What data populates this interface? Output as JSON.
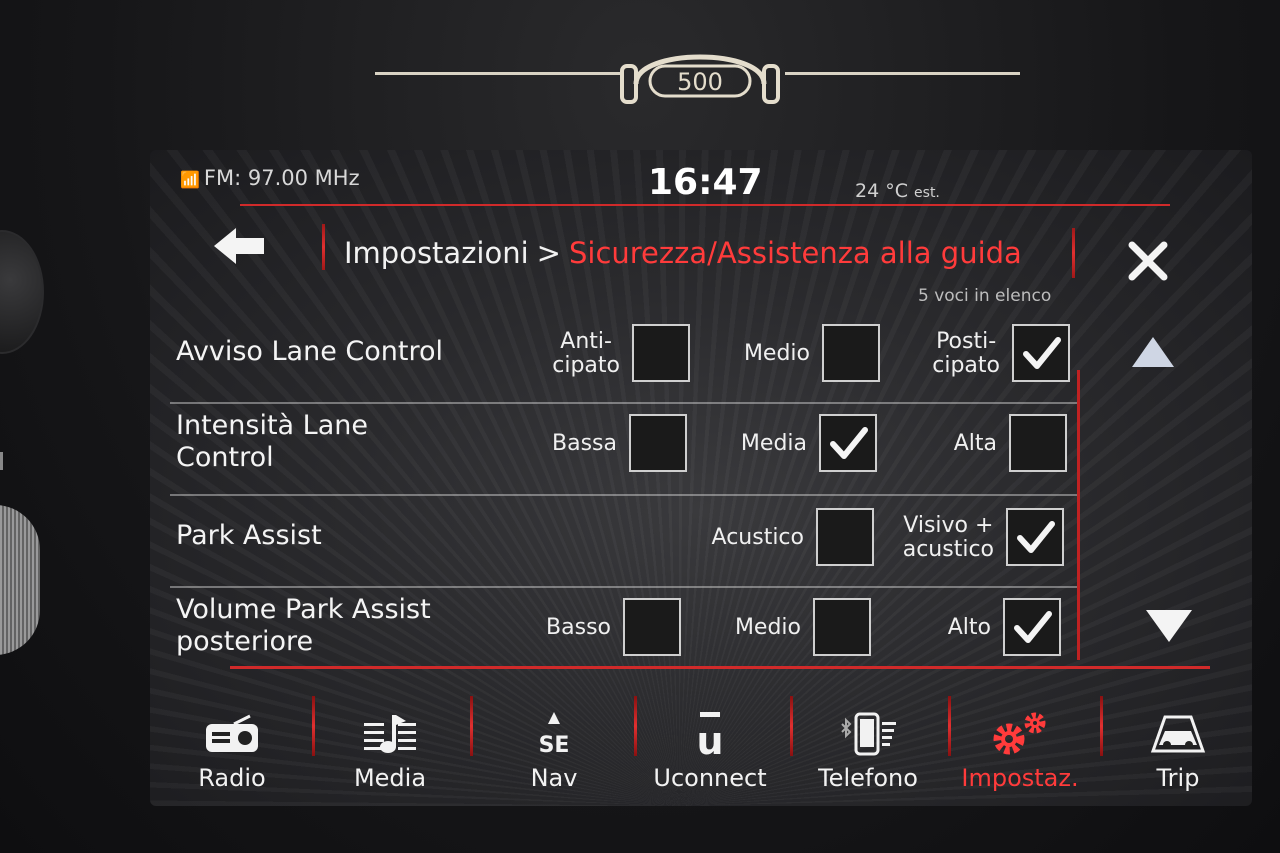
{
  "brand": {
    "logo_text": "500"
  },
  "status": {
    "radio": "FM: 97.00 MHz",
    "clock": "16:47",
    "temperature": "24 °C",
    "temperature_suffix": "est."
  },
  "header": {
    "root": "Impostazioni",
    "separator": ">",
    "current": "Sicurezza/Assistenza alla guida",
    "count": "5 voci in elenco"
  },
  "rows": [
    {
      "label_lines": [
        "Avviso Lane Control"
      ],
      "options": [
        {
          "label_lines": [
            "Anti-",
            "cipato"
          ],
          "checked": false
        },
        {
          "label_lines": [
            "Medio"
          ],
          "checked": false
        },
        {
          "label_lines": [
            "Posti-",
            "cipato"
          ],
          "checked": true
        }
      ]
    },
    {
      "label_lines": [
        "Intensità Lane",
        "Control"
      ],
      "options": [
        {
          "label_lines": [
            "Bassa"
          ],
          "checked": false
        },
        {
          "label_lines": [
            "Media"
          ],
          "checked": true
        },
        {
          "label_lines": [
            "Alta"
          ],
          "checked": false
        }
      ]
    },
    {
      "label_lines": [
        "Park Assist"
      ],
      "options": [
        {
          "label_lines": [
            "Acustico"
          ],
          "checked": false
        },
        {
          "label_lines": [
            "Visivo +",
            "acustico"
          ],
          "checked": true
        }
      ]
    },
    {
      "label_lines": [
        "Volume Park Assist",
        "posteriore"
      ],
      "options": [
        {
          "label_lines": [
            "Basso"
          ],
          "checked": false
        },
        {
          "label_lines": [
            "Medio"
          ],
          "checked": false
        },
        {
          "label_lines": [
            "Alto"
          ],
          "checked": true
        }
      ]
    }
  ],
  "navbar": [
    {
      "label": "Radio",
      "icon": "radio-icon",
      "active": false
    },
    {
      "label": "Media",
      "icon": "media-icon",
      "active": false
    },
    {
      "label": "Nav",
      "icon": "nav-icon",
      "icon_text": "SE",
      "active": false
    },
    {
      "label": "Uconnect",
      "icon": "uconnect-icon",
      "icon_text": "u",
      "active": false
    },
    {
      "label": "Telefono",
      "icon": "phone-icon",
      "active": false
    },
    {
      "label": "Impostaz.",
      "icon": "settings-gear-icon",
      "active": true
    },
    {
      "label": "Trip",
      "icon": "trip-car-icon",
      "active": false
    }
  ],
  "colors": {
    "accent_red": "#ff3b3b",
    "line_red": "#d02a2a",
    "text": "#f2f2f2",
    "checkbox_border": "#cfcfcf"
  }
}
